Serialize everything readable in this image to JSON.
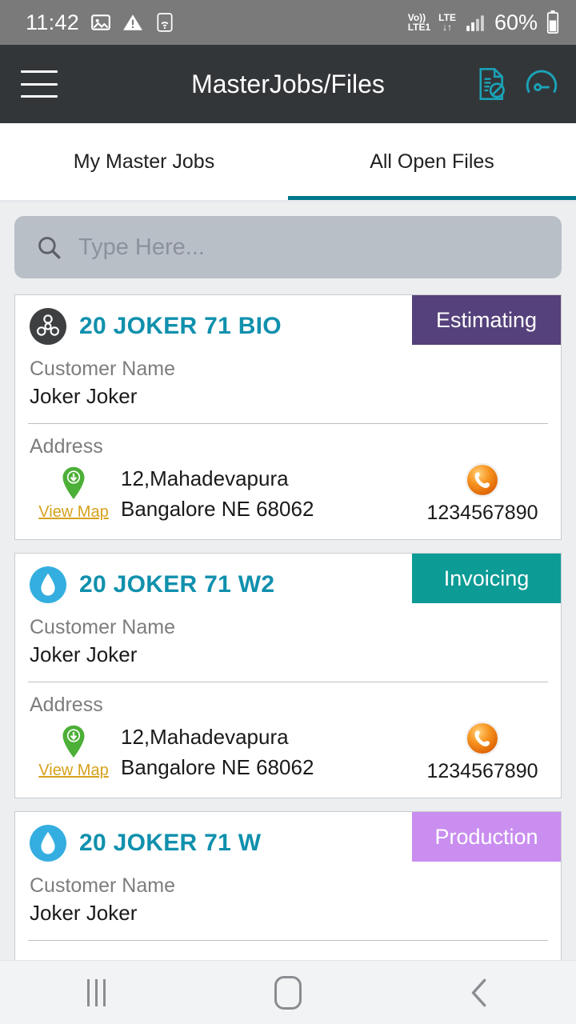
{
  "statusbar": {
    "time": "11:42",
    "icons": [
      "image-icon",
      "warning-icon",
      "wifi-icon"
    ],
    "volte_top": "Vo))",
    "volte_bottom": "LTE1",
    "lte_top": "LTE",
    "lte_bottom": "↓↑",
    "battery_percent": "60%"
  },
  "appbar": {
    "menu_icon": "hamburger-menu-icon",
    "title": "MasterJobs/Files",
    "action_doc_icon": "document-blocked-icon",
    "action_gauge_icon": "gauge-icon",
    "bg_color": "#333639",
    "accent_color": "#1aa3b8"
  },
  "tabs": {
    "items": [
      {
        "label": "My Master Jobs",
        "active": false
      },
      {
        "label": "All Open Files",
        "active": true
      }
    ],
    "indicator_color": "#00788c"
  },
  "search": {
    "icon": "search-icon",
    "placeholder": "Type Here...",
    "value": ""
  },
  "labels": {
    "customer_name": "Customer Name",
    "address": "Address",
    "view_map": "View Map"
  },
  "cards": [
    {
      "icon": "biohazard-icon",
      "icon_type": "biohazard",
      "title": "20 JOKER 71 BIO",
      "status": "Estimating",
      "status_color": "#55417b",
      "customer_name": "Joker Joker",
      "address_line1": "12,Mahadevapura",
      "address_line2": "Bangalore NE 68062",
      "phone": "1234567890",
      "show_address": true
    },
    {
      "icon": "water-drop-icon",
      "icon_type": "waterdrop",
      "title": "20 JOKER 71 W2",
      "status": "Invoicing",
      "status_color": "#0d9b95",
      "customer_name": "Joker Joker",
      "address_line1": "12,Mahadevapura",
      "address_line2": "Bangalore NE 68062",
      "phone": "1234567890",
      "show_address": true
    },
    {
      "icon": "water-drop-icon",
      "icon_type": "waterdrop",
      "title": "20 JOKER 71 W",
      "status": "Production",
      "status_color": "#c98ef0",
      "customer_name": "Joker Joker",
      "address_line1": "",
      "address_line2": "",
      "phone": "",
      "show_address": false
    }
  ],
  "navbar": {
    "recents": "recents-icon",
    "home": "home-icon",
    "back": "back-icon"
  }
}
